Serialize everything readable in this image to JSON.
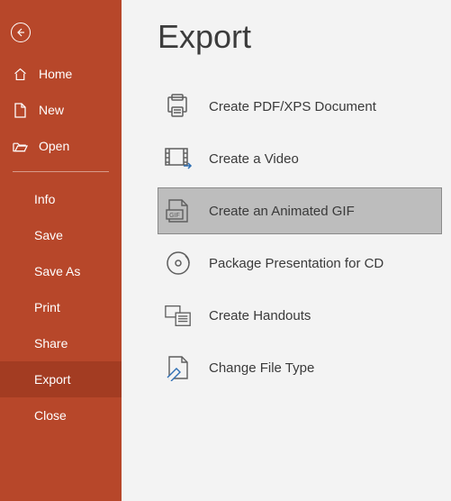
{
  "colors": {
    "sidebar": "#B7472A",
    "sidebar_active": "#A33C22",
    "main_bg": "#f3f3f3",
    "selected_bg": "#bdbdbd"
  },
  "sidebar": {
    "nav": [
      {
        "label": "Home"
      },
      {
        "label": "New"
      },
      {
        "label": "Open"
      }
    ],
    "items": [
      {
        "label": "Info"
      },
      {
        "label": "Save"
      },
      {
        "label": "Save As"
      },
      {
        "label": "Print"
      },
      {
        "label": "Share"
      },
      {
        "label": "Export"
      },
      {
        "label": "Close"
      }
    ],
    "active_index": 5
  },
  "main": {
    "title": "Export",
    "options": [
      {
        "label": "Create PDF/XPS Document"
      },
      {
        "label": "Create a Video"
      },
      {
        "label": "Create an Animated GIF"
      },
      {
        "label": "Package Presentation for CD"
      },
      {
        "label": "Create Handouts"
      },
      {
        "label": "Change File Type"
      }
    ],
    "selected_index": 2
  }
}
